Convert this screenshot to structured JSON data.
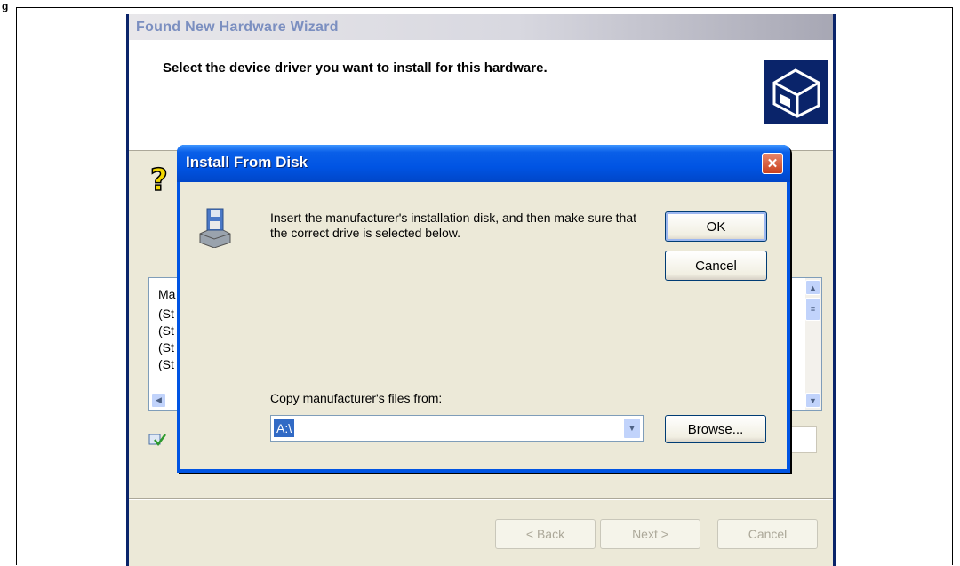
{
  "doc_label": "g",
  "wizard": {
    "title": "Found New Hardware Wizard",
    "heading": "Select the device driver you want to install for this hardware.",
    "list": {
      "column_header": "Ma",
      "items": [
        "(St",
        "(St",
        "(St",
        "(St"
      ]
    },
    "buttons": {
      "back": "< Back",
      "next": "Next >",
      "cancel": "Cancel"
    }
  },
  "dialog": {
    "title": "Install From Disk",
    "message": "Insert the manufacturer's installation disk, and then make sure that the correct drive is selected below.",
    "ok_label": "OK",
    "cancel_label": "Cancel",
    "copy_label": "Copy manufacturer's files from:",
    "path_value": "A:\\",
    "browse_label": "Browse..."
  },
  "colors": {
    "titlebar_blue": "#0054e3",
    "dialog_face": "#ece9d8",
    "selection": "#316ac5"
  },
  "icons": [
    "hardware-icon",
    "help-icon",
    "floppy-drive-icon",
    "close-icon",
    "signed-driver-icon",
    "chevron-down-icon"
  ]
}
